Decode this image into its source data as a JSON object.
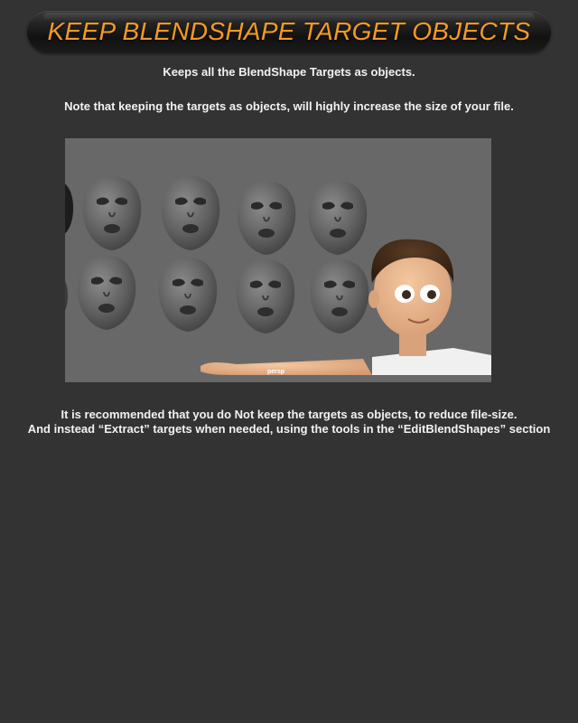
{
  "header": {
    "title": "KEEP BLENDSHAPE TARGET OBJECTS"
  },
  "intro": {
    "line1": "Keeps all the BlendShape Targets as objects.",
    "line2": "Note that keeping the targets as objects, will highly increase the size of your file."
  },
  "viewport": {
    "camera_label": "persp"
  },
  "recommendation": {
    "line1": "It is recommended that you do Not keep the targets as objects, to reduce file-size.",
    "line2": "And instead “Extract” targets when needed, using the tools in the “EditBlendShapes” section"
  },
  "colors": {
    "title": "#f39a25",
    "background": "#333333",
    "viewport": "#686868"
  }
}
